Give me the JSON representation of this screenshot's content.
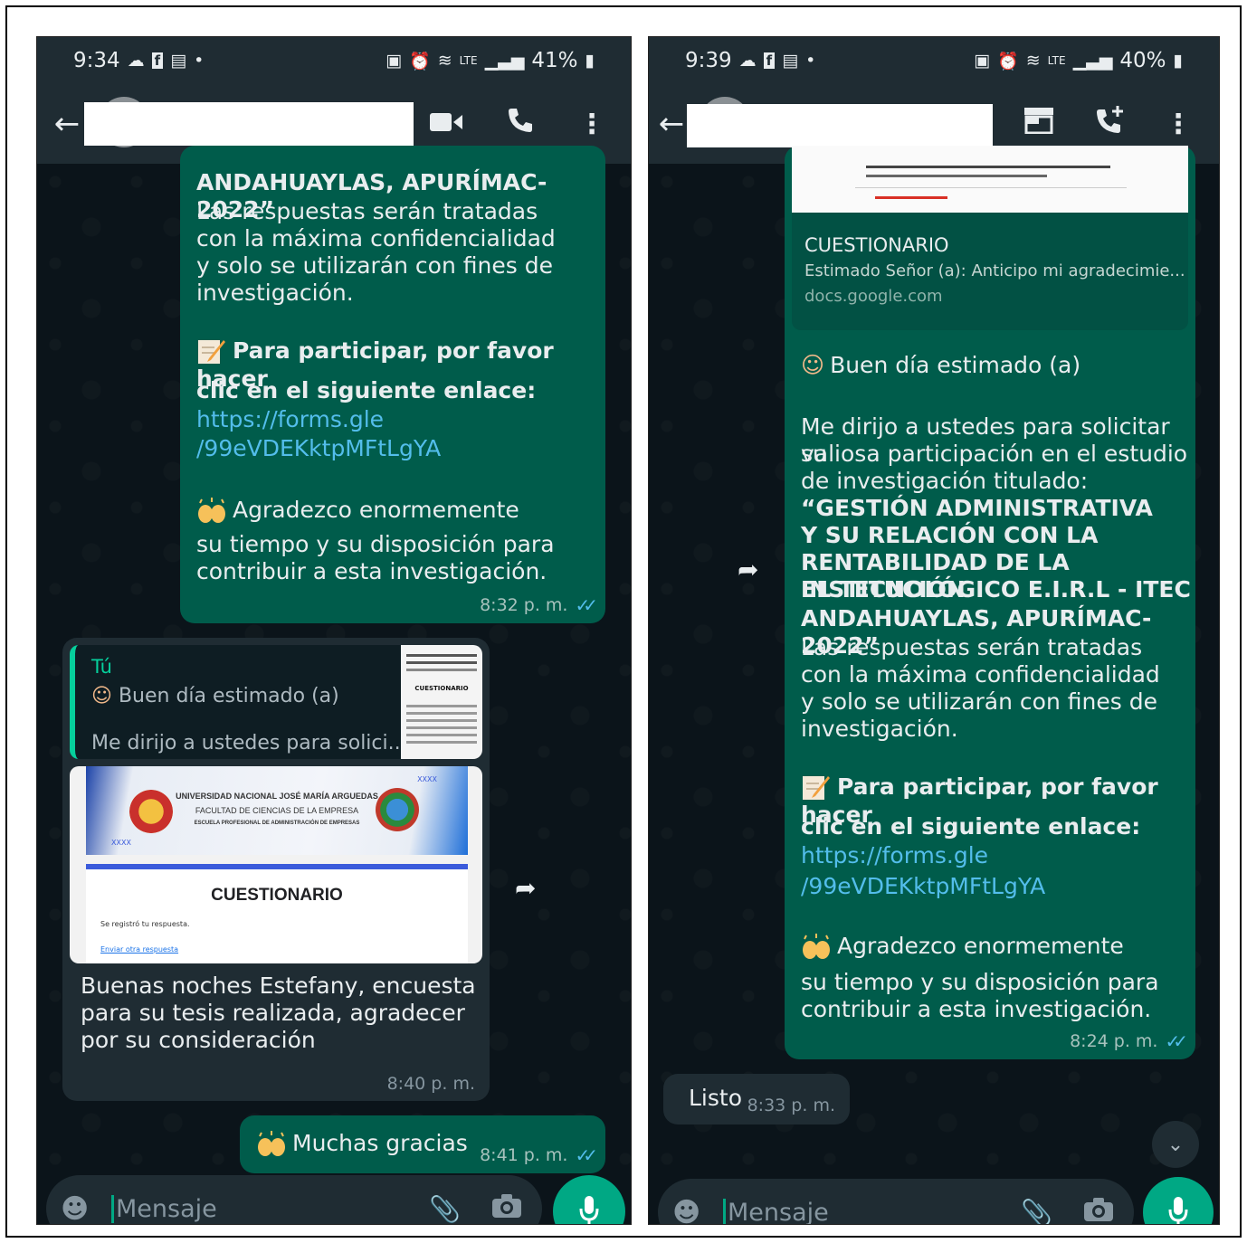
{
  "left": {
    "status": {
      "time": "9:34",
      "battery": "41%",
      "network": "LTE"
    },
    "icons": {
      "back": "arrow-left-icon",
      "video": "video-call-icon",
      "call": "phone-icon",
      "menu": "more-vert-icon"
    },
    "msg1": {
      "title_tail": "ANDAHUAYLAS, APURÍMAC-2022”",
      "body": [
        "Las respuestas serán tratadas",
        "con la máxima confidencialidad",
        "y solo se utilizarán con fines de",
        "investigación."
      ],
      "participate_1": "Para participar, por favor hacer",
      "participate_2": "clic en el siguiente enlace:",
      "link_1": "https://forms.gle",
      "link_2": "/99eVDEKktpMFtLgYA",
      "thanks_1": "Agradezco enormemente",
      "thanks_2": "su tiempo y su disposición para",
      "thanks_3": "contribuir a esta investigación.",
      "time": "8:32 p. m."
    },
    "msg2": {
      "quote_author": "Tú",
      "quote_line1": "Buen día estimado (a)",
      "quote_line2": "Me dirijo a ustedes para solici...",
      "thumb_title": "CUESTIONARIO",
      "banner_line1": "UNIVERSIDAD NACIONAL JOSÉ MARÍA ARGUEDAS",
      "banner_line2": "FACULTAD DE CIENCIAS DE LA EMPRESA",
      "banner_line3": "ESCUELA PROFESIONAL DE ADMINISTRACIÓN DE EMPRESAS",
      "banner_tag": "XXXX",
      "form_title": "CUESTIONARIO",
      "form_note": "Se registró tu respuesta.",
      "form_link": "Enviar otra respuesta",
      "text": [
        "Buenas noches Estefany, encuesta",
        "para su tesis realizada, agradecer",
        "por su consideración"
      ],
      "time": "8:40 p. m."
    },
    "msg3": {
      "text": "Muchas gracias",
      "time": "8:41 p. m."
    },
    "input": {
      "placeholder": "Mensaje"
    }
  },
  "right": {
    "status": {
      "time": "9:39",
      "battery": "40%",
      "network": "LTE"
    },
    "icons": {
      "back": "arrow-left-icon",
      "store": "store-icon",
      "call": "add-call-icon",
      "menu": "more-vert-icon"
    },
    "preview": {
      "title": "CUESTIONARIO",
      "desc": "Estimado Señor (a): Anticipo mi agradecimie...",
      "domain": "docs.google.com"
    },
    "msg": {
      "greeting": "Buen día estimado (a)",
      "intro": [
        "Me dirijo a ustedes para solicitar su",
        "valiosa participación en el estudio",
        "de investigación titulado:"
      ],
      "title": [
        "“GESTIÓN ADMINISTRATIVA",
        "Y SU RELACIÓN CON LA",
        "RENTABILIDAD DE LA INSTITUCIÓN",
        "EL TECNOLÓGICO E.I.R.L - ITEC",
        "ANDAHUAYLAS, APURÍMAC-2022”"
      ],
      "body": [
        "Las respuestas serán tratadas",
        "con la máxima confidencialidad",
        "y solo se utilizarán con fines de",
        "investigación."
      ],
      "participate_1": "Para participar, por favor hacer",
      "participate_2": "clic en el siguiente enlace:",
      "link_1": "https://forms.gle",
      "link_2": "/99eVDEKktpMFtLgYA",
      "thanks_1": "Agradezco enormemente",
      "thanks_2": "su tiempo y su disposición para",
      "thanks_3": "contribuir a esta investigación.",
      "time": "8:24 p. m."
    },
    "reply": {
      "text": "Listo",
      "time": "8:33 p. m."
    },
    "input": {
      "placeholder": "Mensaje"
    }
  }
}
